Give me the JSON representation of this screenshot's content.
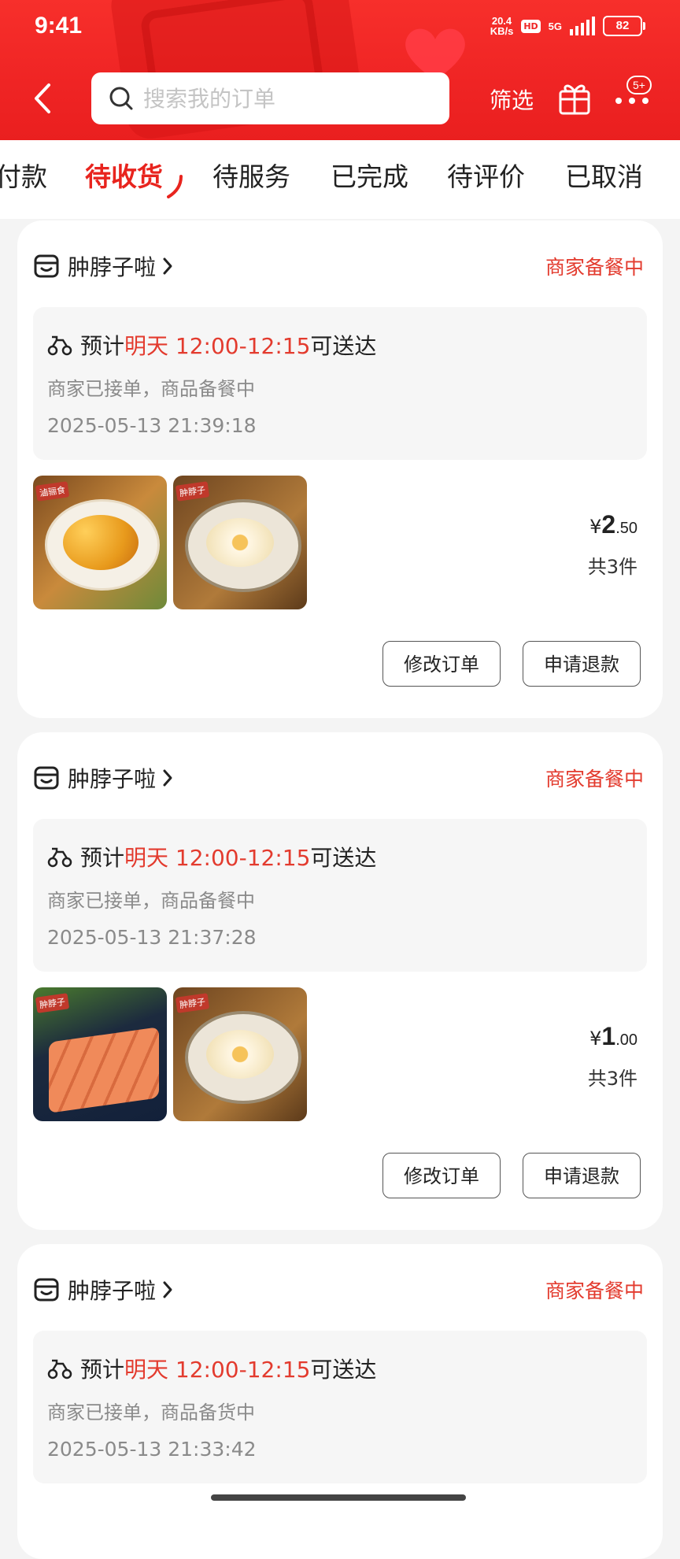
{
  "status_bar": {
    "time": "9:41",
    "net_speed_value": "20.4",
    "net_speed_unit": "KB/s",
    "hd_badge": "HD",
    "signal_label": "5G",
    "battery": "82"
  },
  "header": {
    "search_placeholder": "搜索我的订单",
    "filter_label": "筛选",
    "more_badge": "5+"
  },
  "tabs": [
    {
      "label": "付款",
      "active": false
    },
    {
      "label": "待收货",
      "active": true
    },
    {
      "label": "待服务",
      "active": false
    },
    {
      "label": "已完成",
      "active": false
    },
    {
      "label": "待评价",
      "active": false
    },
    {
      "label": "已取消",
      "active": false
    }
  ],
  "orders": [
    {
      "store_name": "肿脖子啦",
      "status": "商家备餐中",
      "eta_prefix": "预计",
      "eta_highlight": "明天 12:00-12:15",
      "eta_suffix": "可送达",
      "substatus": "商家已接单，商品备餐中",
      "timestamp": "2025-05-13 21:39:18",
      "images": [
        {
          "tag": "滷骊食",
          "kind": "popcorn-chicken"
        },
        {
          "tag": "肿脖子",
          "kind": "fried-egg"
        }
      ],
      "currency": "¥",
      "price_int": "2",
      "price_dec": ".50",
      "quantity": "共3件",
      "btn_modify": "修改订单",
      "btn_refund": "申请退款"
    },
    {
      "store_name": "肿脖子啦",
      "status": "商家备餐中",
      "eta_prefix": "预计",
      "eta_highlight": "明天 12:00-12:15",
      "eta_suffix": "可送达",
      "substatus": "商家已接单，商品备餐中",
      "timestamp": "2025-05-13 21:37:28",
      "images": [
        {
          "tag": "肿脖子",
          "kind": "luncheon-meat"
        },
        {
          "tag": "肿脖子",
          "kind": "fried-egg"
        }
      ],
      "currency": "¥",
      "price_int": "1",
      "price_dec": ".00",
      "quantity": "共3件",
      "btn_modify": "修改订单",
      "btn_refund": "申请退款"
    },
    {
      "store_name": "肿脖子啦",
      "status": "商家备餐中",
      "eta_prefix": "预计",
      "eta_highlight": "明天 12:00-12:15",
      "eta_suffix": "可送达",
      "substatus": "商家已接单，商品备货中",
      "timestamp": "2025-05-13 21:33:42"
    }
  ],
  "colors": {
    "brand_red": "#ef2424",
    "accent_text": "#e33b2e",
    "card_bg": "#ffffff",
    "page_bg": "#f4f4f4"
  }
}
